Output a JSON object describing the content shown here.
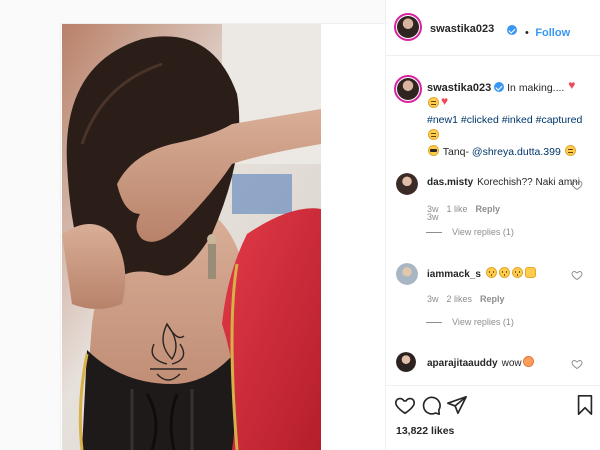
{
  "post": {
    "username": "swastika023",
    "follow_label": "Follow",
    "separator": "•"
  },
  "caption": {
    "username": "swastika023",
    "text_start": "In making....",
    "hashtags": [
      "#new1",
      "#clicked",
      "#inked",
      "#captured"
    ],
    "credit_prefix": "Tanq-",
    "mention": "@shreya.dutta.399",
    "time": "3w"
  },
  "comments": [
    {
      "username": "das.misty",
      "text": "Korechish?? Naki amni",
      "time": "3w",
      "likes": "1 like",
      "reply_label": "Reply",
      "view_replies": "View replies (1)"
    },
    {
      "username": "iammack_s",
      "text": "",
      "time": "3w",
      "likes": "2 likes",
      "reply_label": "Reply",
      "view_replies": "View replies (1)"
    },
    {
      "username": "aparajitaauddy",
      "text": "wow"
    }
  ],
  "actions": {
    "icons": [
      "heart-icon",
      "comment-icon",
      "share-icon",
      "bookmark-icon"
    ]
  },
  "likes_count": "13,822 likes",
  "colors": {
    "link_blue": "#3897f0",
    "hashtag": "#00376b",
    "muted": "#8e8e8e",
    "text": "#262626",
    "story_ring": "#d6249f"
  }
}
